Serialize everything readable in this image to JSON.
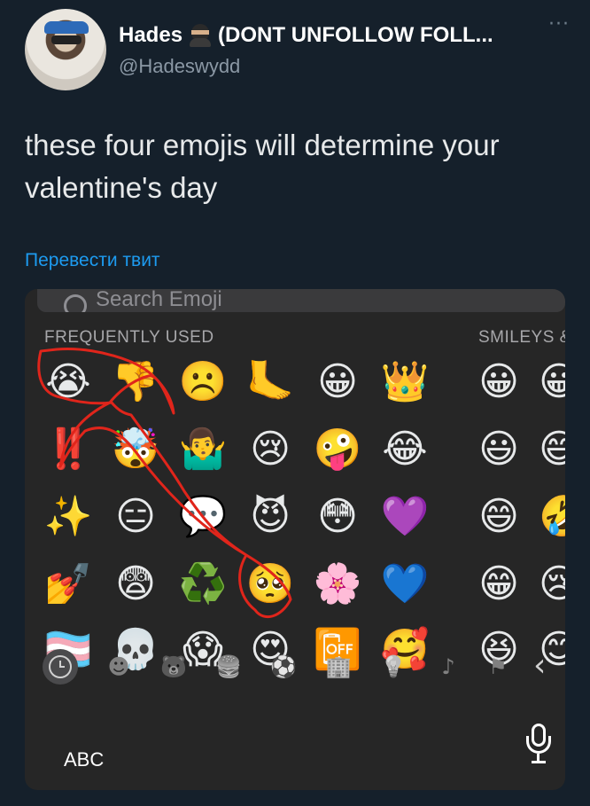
{
  "tweet": {
    "display_name": "Hades",
    "display_name_rest": "(DONT UNFOLLOW FOLL...",
    "handle": "@Hadeswydd",
    "more_icon": "more-dots-icon",
    "text": "these four emojis will determine your valentine's day",
    "translate_link": "Перевести твит"
  },
  "keyboard": {
    "search_placeholder": "Search Emoji",
    "frequently_used_label": "FREQUENTLY USED",
    "smileys_label": "SMILEYS &",
    "frequent_rows": [
      [
        "😭",
        "👎",
        "☹️",
        "🦶",
        "😀",
        "👑"
      ],
      [
        "‼️",
        "🤯",
        "🤷‍♂️",
        "😢",
        "🤪",
        "😂"
      ],
      [
        "✨",
        "😑",
        "💬",
        "😈",
        "😳",
        "💜"
      ],
      [
        "💅",
        "😨",
        "♻️",
        "🥺",
        "🌸",
        "💙"
      ],
      [
        "🏳️‍⚧️",
        "💀",
        "😱",
        "😍",
        "📴",
        "🥰"
      ]
    ],
    "smileys_column": [
      "😀",
      "😃",
      "😄",
      "😁",
      "😆"
    ],
    "smileys_partial_column": [
      "😀",
      "😅",
      "🤣",
      "😢",
      "😊"
    ],
    "categories": [
      {
        "name": "recent",
        "icon": "clock-icon",
        "glyph": ""
      },
      {
        "name": "smileys",
        "icon": "smiley-icon",
        "glyph": "☻"
      },
      {
        "name": "animals",
        "icon": "bear-icon",
        "glyph": "🐻"
      },
      {
        "name": "food",
        "icon": "food-icon",
        "glyph": "🍔"
      },
      {
        "name": "activity",
        "icon": "soccer-ball-icon",
        "glyph": "⚽"
      },
      {
        "name": "travel",
        "icon": "building-icon",
        "glyph": "🏢"
      },
      {
        "name": "objects",
        "icon": "lightbulb-icon",
        "glyph": "💡"
      },
      {
        "name": "symbols",
        "icon": "symbols-icon",
        "glyph": "♪"
      },
      {
        "name": "flags",
        "icon": "flag-icon",
        "glyph": "⚑"
      }
    ],
    "abc_label": "ABC",
    "annotation_color": "#e0251b"
  }
}
